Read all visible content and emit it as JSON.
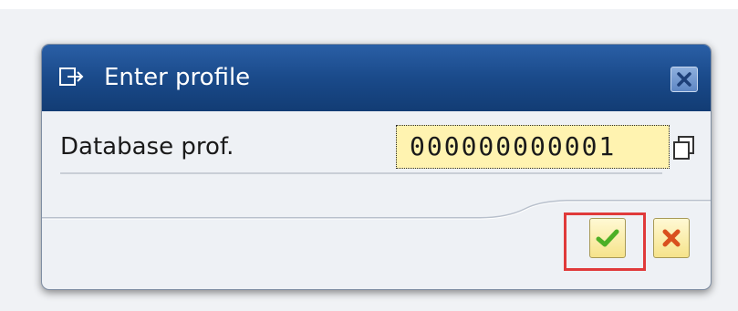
{
  "dialog": {
    "title": "Enter profile",
    "title_icon": "profile-enter-icon",
    "close_icon": "close-icon"
  },
  "field": {
    "label": "Database prof.",
    "value": "000000000001",
    "help_icon": "possible-entries-icon"
  },
  "buttons": {
    "ok_icon": "checkmark-icon",
    "cancel_icon": "cancel-x-icon"
  },
  "colors": {
    "titlebar": "#1a4a8a",
    "input_background": "#fff3b0",
    "highlight": "#e03a3a",
    "ok_check": "#4caf26",
    "cancel_x": "#d9501e"
  }
}
